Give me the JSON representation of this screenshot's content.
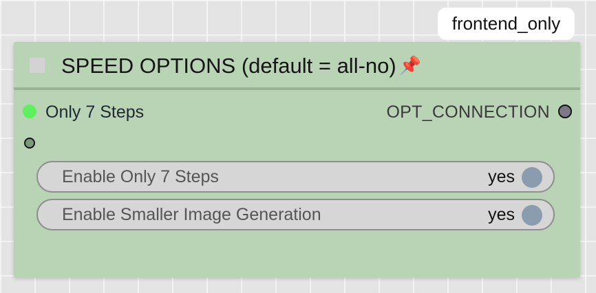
{
  "badge": {
    "label": "frontend_only"
  },
  "node": {
    "title": "SPEED OPTIONS (default = all-no)",
    "pin_icon": "📌",
    "inputs": [
      {
        "label": "Only 7 Steps",
        "connected": true
      },
      {
        "label": "",
        "connected": false
      }
    ],
    "outputs": [
      {
        "label": "OPT_CONNECTION"
      }
    ],
    "widgets": [
      {
        "label": "Enable Only 7 Steps",
        "value": "yes"
      },
      {
        "label": "Enable Smaller Image Generation",
        "value": "yes"
      }
    ]
  },
  "colors": {
    "node_bg": "#b9d3b5",
    "header_divider": "#99b394",
    "active_slot": "#5ef05e",
    "output_slot": "#7c7886",
    "toggle_knob": "#8a9cad",
    "widget_bg": "#d6d6d6"
  },
  "icons": {
    "pin": "pushpin-icon",
    "collapse": "collapse-toggle-icon"
  }
}
